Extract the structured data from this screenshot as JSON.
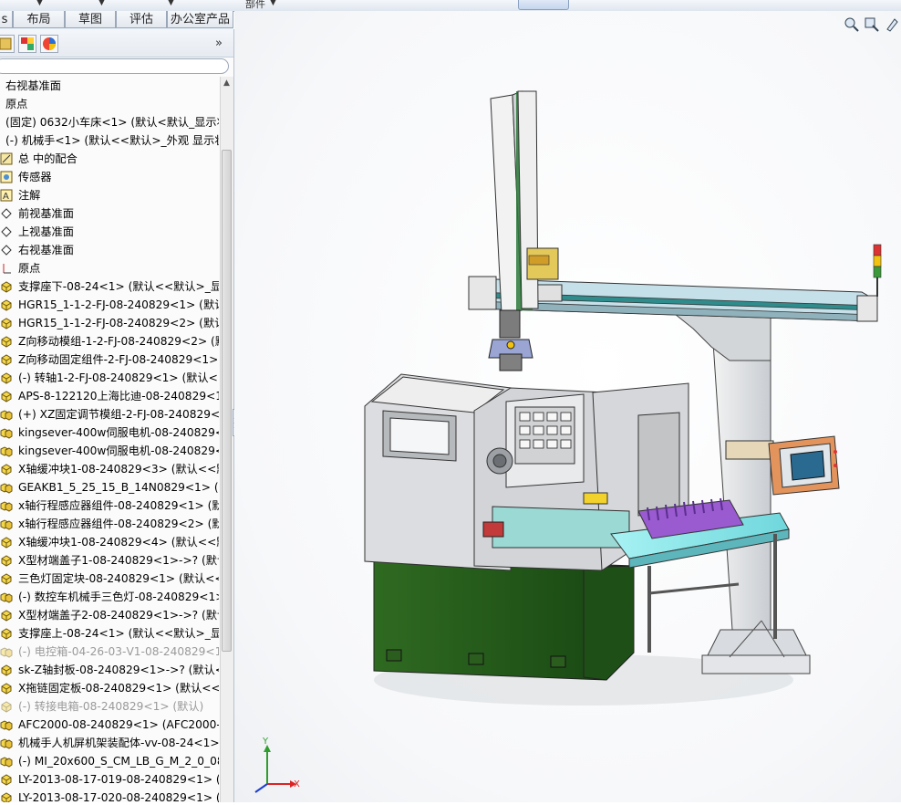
{
  "ribbon": {
    "part_label": "部件",
    "tabs": [
      "s",
      "布局",
      "草图",
      "评估",
      "办公室产品"
    ]
  },
  "panel": {
    "expand_label": "»",
    "tree": [
      {
        "icon": "plane-icon",
        "label": "右视基准面",
        "dim": false,
        "indent": 0
      },
      {
        "icon": "origin-icon",
        "label": "原点",
        "dim": false,
        "indent": 0
      },
      {
        "icon": "part-icon",
        "label": "(固定) 0632小车床<1> (默认<默认_显示状态",
        "dim": false,
        "indent": 0
      },
      {
        "icon": "assembly-icon",
        "label": "(-) 机械手<1> (默认<<默认>_外观 显示状态",
        "dim": false,
        "indent": 0
      },
      {
        "icon": "mate-icon",
        "label": "总 中的配合",
        "dim": false,
        "indent": 1
      },
      {
        "icon": "sensor-icon",
        "label": "传感器",
        "dim": false,
        "indent": 1
      },
      {
        "icon": "annotation-icon",
        "label": "注解",
        "dim": false,
        "indent": 1
      },
      {
        "icon": "plane-icon",
        "label": "前视基准面",
        "dim": false,
        "indent": 1
      },
      {
        "icon": "plane-icon",
        "label": "上视基准面",
        "dim": false,
        "indent": 1
      },
      {
        "icon": "plane-icon",
        "label": "右视基准面",
        "dim": false,
        "indent": 1
      },
      {
        "icon": "origin-icon",
        "label": "原点",
        "dim": false,
        "indent": 1
      },
      {
        "icon": "part-icon",
        "label": "支撑座下-08-24<1> (默认<<默认>_显示",
        "dim": false,
        "indent": 1
      },
      {
        "icon": "part-icon",
        "label": "HGR15_1-1-2-FJ-08-240829<1> (默认-",
        "dim": false,
        "indent": 1
      },
      {
        "icon": "part-icon",
        "label": "HGR15_1-1-2-FJ-08-240829<2> (默认-",
        "dim": false,
        "indent": 1
      },
      {
        "icon": "part-icon",
        "label": "Z向移动模组-1-2-FJ-08-240829<2> (默",
        "dim": false,
        "indent": 1
      },
      {
        "icon": "part-icon",
        "label": "Z向移动固定组件-2-FJ-08-240829<1> (",
        "dim": false,
        "indent": 1
      },
      {
        "icon": "part-icon",
        "label": "(-) 转轴1-2-FJ-08-240829<1> (默认<<",
        "dim": false,
        "indent": 1
      },
      {
        "icon": "part-icon",
        "label": "APS-8-122120上海比迪-08-240829<1>",
        "dim": false,
        "indent": 1
      },
      {
        "icon": "assembly-icon",
        "label": "(+) XZ固定调节模组-2-FJ-08-240829<2",
        "dim": false,
        "indent": 1
      },
      {
        "icon": "assembly-icon",
        "label": "kingsever-400w伺服电机-08-240829<1",
        "dim": false,
        "indent": 1
      },
      {
        "icon": "assembly-icon",
        "label": "kingsever-400w伺服电机-08-240829<2",
        "dim": false,
        "indent": 1
      },
      {
        "icon": "part-icon",
        "label": "X轴缓冲块1-08-240829<3> (默认<<默",
        "dim": false,
        "indent": 1
      },
      {
        "icon": "assembly-icon",
        "label": "GEAKB1_5_25_15_B_14N0829<1> (GE",
        "dim": false,
        "indent": 1
      },
      {
        "icon": "assembly-icon",
        "label": "x轴行程感应器组件-08-240829<1> (默认",
        "dim": false,
        "indent": 1
      },
      {
        "icon": "assembly-icon",
        "label": "x轴行程感应器组件-08-240829<2> (默认",
        "dim": false,
        "indent": 1
      },
      {
        "icon": "part-icon",
        "label": "X轴缓冲块1-08-240829<4> (默认<<默",
        "dim": false,
        "indent": 1
      },
      {
        "icon": "part-icon",
        "label": "X型材端盖子1-08-240829<1>->? (默认",
        "dim": false,
        "indent": 1
      },
      {
        "icon": "part-icon",
        "label": "三色灯固定块-08-240829<1> (默认<<默",
        "dim": false,
        "indent": 1
      },
      {
        "icon": "assembly-icon",
        "label": "(-) 数控车机械手三色灯-08-240829<1> (",
        "dim": false,
        "indent": 1
      },
      {
        "icon": "part-icon",
        "label": "X型材端盖子2-08-240829<1>->? (默认",
        "dim": false,
        "indent": 1
      },
      {
        "icon": "part-icon",
        "label": "支撑座上-08-24<1> (默认<<默认>_显示",
        "dim": false,
        "indent": 1
      },
      {
        "icon": "assembly-icon",
        "label": "(-) 电控箱-04-26-03-V1-08-240829<1>",
        "dim": true,
        "indent": 1
      },
      {
        "icon": "part-icon",
        "label": "sk-Z轴封板-08-240829<1>->? (默认<<",
        "dim": false,
        "indent": 1
      },
      {
        "icon": "part-icon",
        "label": "X拖链固定板-08-240829<1> (默认<<默",
        "dim": false,
        "indent": 1
      },
      {
        "icon": "part-icon",
        "label": "(-) 转接电箱-08-240829<1> (默认)",
        "dim": true,
        "indent": 1
      },
      {
        "icon": "assembly-icon",
        "label": "AFC2000-08-240829<1> (AFC2000-P<",
        "dim": false,
        "indent": 1
      },
      {
        "icon": "assembly-icon",
        "label": "机械手人机屏机架装配体-vv-08-24<1> (",
        "dim": false,
        "indent": 1
      },
      {
        "icon": "assembly-icon",
        "label": "(-) MI_20x600_S_CM_LB_G_M_2_0_0829",
        "dim": false,
        "indent": 1
      },
      {
        "icon": "part-icon",
        "label": "LY-2013-08-17-019-08-240829<1> (D",
        "dim": false,
        "indent": 1
      },
      {
        "icon": "part-icon",
        "label": "LY-2013-08-17-020-08-240829<1> (D",
        "dim": false,
        "indent": 1
      }
    ]
  },
  "viewport": {
    "triad": {
      "x_label": "X",
      "y_label": "Y",
      "z_label": "Z"
    },
    "tools": [
      "zoom-to-fit-icon",
      "zoom-area-icon",
      "previous-view-icon"
    ]
  }
}
